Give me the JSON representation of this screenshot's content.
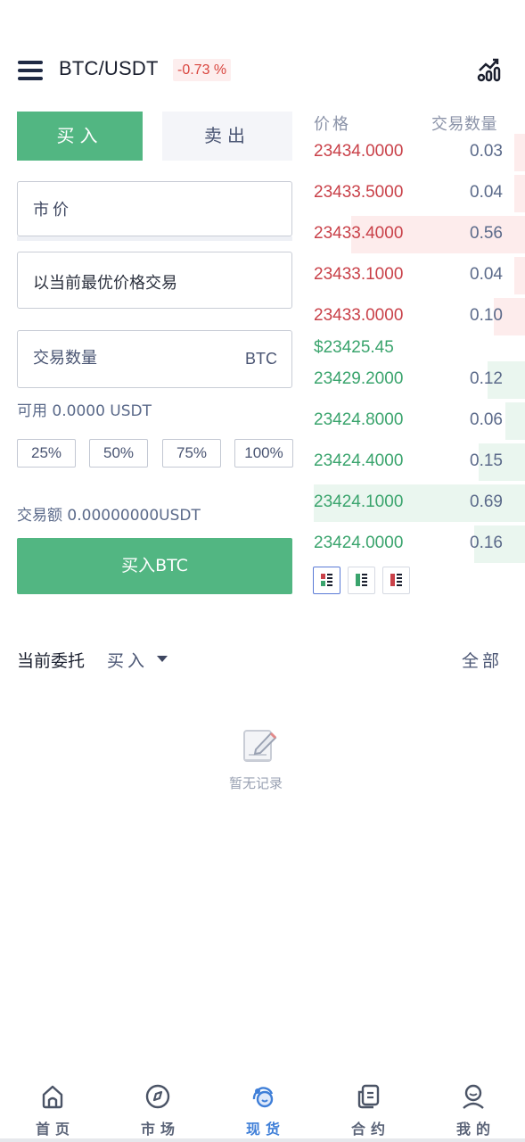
{
  "header": {
    "pair": "BTC/USDT",
    "change": "-0.73 %",
    "icons": {
      "menu": "hamburger-menu-icon",
      "chart": "kline-chart-icon"
    }
  },
  "tabs": {
    "buy": "买入",
    "sell": "卖出"
  },
  "form": {
    "order_type": "市价",
    "best_price_text": "以当前最优价格交易",
    "amount_placeholder": "交易数量",
    "amount_unit": "BTC",
    "available": "可用 0.0000 USDT",
    "percents": [
      "25%",
      "50%",
      "75%",
      "100%"
    ],
    "trade_total": "交易额 0.00000000USDT",
    "submit": "买入BTC"
  },
  "orderbook": {
    "price_header": "价格",
    "qty_header": "交易数量",
    "asks": [
      {
        "price": "23434.0000",
        "qty": "0.03",
        "depth": 0.05
      },
      {
        "price": "23433.5000",
        "qty": "0.04",
        "depth": 0.05
      },
      {
        "price": "23433.4000",
        "qty": "0.56",
        "depth": 0.79
      },
      {
        "price": "23433.1000",
        "qty": "0.04",
        "depth": 0.05
      },
      {
        "price": "23433.0000",
        "qty": "0.10",
        "depth": 0.14
      }
    ],
    "last_price": "$23425.45",
    "bids": [
      {
        "price": "23429.2000",
        "qty": "0.12",
        "depth": 0.17
      },
      {
        "price": "23424.8000",
        "qty": "0.06",
        "depth": 0.09
      },
      {
        "price": "23424.4000",
        "qty": "0.15",
        "depth": 0.21
      },
      {
        "price": "23424.1000",
        "qty": "0.69",
        "depth": 0.96
      },
      {
        "price": "23424.0000",
        "qty": "0.16",
        "depth": 0.23
      }
    ],
    "colors": {
      "ask": "#c94149",
      "bid": "#3aa46d",
      "ask_bg": "#fdecec",
      "bid_bg": "#eaf6ef"
    }
  },
  "orders": {
    "title": "当前委托",
    "filter": "买入",
    "all": "全部",
    "empty": "暂无记录"
  },
  "nav": [
    {
      "label": "首页",
      "icon": "home-icon",
      "active": false
    },
    {
      "label": "市场",
      "icon": "market-icon",
      "active": false
    },
    {
      "label": "现货",
      "icon": "spot-icon",
      "active": true
    },
    {
      "label": "合约",
      "icon": "contract-icon",
      "active": false
    },
    {
      "label": "我的",
      "icon": "profile-icon",
      "active": false
    }
  ],
  "colors": {
    "buy": "#52b682",
    "accent": "#3f7fd8",
    "down": "#d9463f"
  }
}
